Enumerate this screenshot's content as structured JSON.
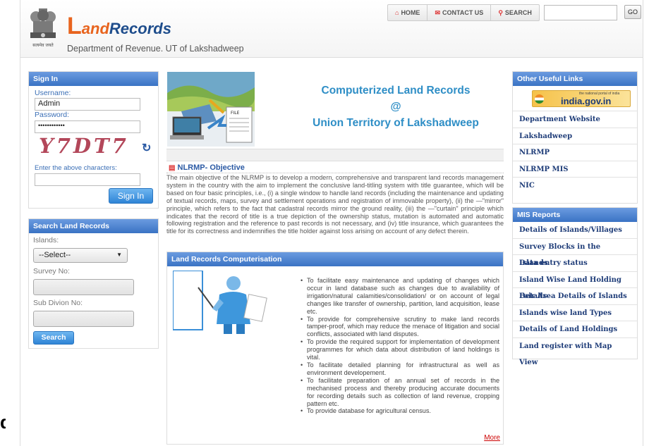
{
  "header": {
    "logo_letter": "L",
    "logo_and": "and",
    "logo_records": "Records",
    "department": "Department of Revenue.  UT of Lakshadweep",
    "emblem_caption": "सत्यमेव जयते",
    "nav": [
      {
        "icon": "home-icon",
        "label": "HOME"
      },
      {
        "icon": "mail-icon",
        "label": "CONTACT US"
      },
      {
        "icon": "search-icon",
        "label": "SEARCH"
      }
    ],
    "search_value": "",
    "go_label": "GO"
  },
  "signin": {
    "title": "Sign In",
    "username_label": "Username:",
    "username_value": "Admin",
    "password_label": "Password:",
    "password_value": "••••••••••••",
    "captcha": "Y7DT7",
    "captcha_prompt": "Enter the above characters:",
    "captcha_value": "",
    "button": "Sign In"
  },
  "search_records": {
    "title": "Search Land Records",
    "islands_label": "Islands:",
    "islands_selected": "--Select--",
    "survey_label": "Survey No:",
    "survey_value": "",
    "subdiv_label": "Sub Divion No:",
    "subdiv_value": "",
    "button": "Search"
  },
  "banner": {
    "line1": "Computerized Land Records",
    "line2": "@",
    "line3": "Union Territory of Lakshadweep",
    "image_caption": "FILE"
  },
  "objective": {
    "title": "NLRMP- Objective",
    "text": "The main objective of the NLRMP is to develop a modern, comprehensive and transparent land records management system in the country with the aim to implement the conclusive land-titling system with title guarantee, which will be based on four basic principles, i.e., (i) a single window to handle land records (including the maintenance and updating of textual records, maps, survey and settlement operations and registration of immovable property), (ii) the —\"mirror\" principle, which refers to the fact that cadastral records mirror the ground reality, (iii) the —\"curtain\" principle which indicates that the record of title is a true depiction of the ownership status, mutation is automated and automatic following registration and the reference to past records is not necessary, and (iv) title insurance, which guarantees the title for its correctness and indemnifies the title holder against loss arising on account of any defect therein."
  },
  "computerisation": {
    "title": "Land Records Computerisation",
    "bullets": [
      "To facilitate easy maintenance and updating of changes which occur in land database such as changes due to availability of irrigation/natural calamities/consolidation/ or on account of legal changes like transfer of ownership, partition, land acquisition, lease etc.",
      "To provide for comprehensive scrutiny to make land records tamper-proof, which may reduce the menace of litigation and social conflicts, associated with land disputes.",
      "To provide the required support for implementation of development programmes for which data about distribution of land holdings is vital.",
      "To facilitate detailed planning for infrastructural as well as environment developement.",
      "To facilitate preparation of an annual set of records in the mechanised process and thereby producing accurate documents for recording details such as collection of land revenue, cropping pattern etc.",
      "To provide database for agricultural census."
    ],
    "more": "More"
  },
  "useful_links": {
    "title": "Other Useful Links",
    "india_portal": "india.gov.in",
    "india_portal_tag": "the national portal of india",
    "items": [
      "Department Website",
      "Lakshadweep",
      "NLRMP",
      "NLRMP MIS",
      "NIC"
    ]
  },
  "mis_reports": {
    "title": "MIS Reports",
    "items": [
      "Details of Islands/Villages",
      "Survey Blocks in the Islands",
      "Data entry status",
      "Island Wise Land Holding Details",
      "Fair Area Details of Islands",
      "Islands wise land Types",
      "Details of Land Holdings",
      "Land register with Map View"
    ]
  },
  "colors": {
    "header_blue": "#3a73c4",
    "accent_orange": "#e8641e",
    "title_cyan": "#2e8ec6"
  },
  "stray_glyph": "d"
}
